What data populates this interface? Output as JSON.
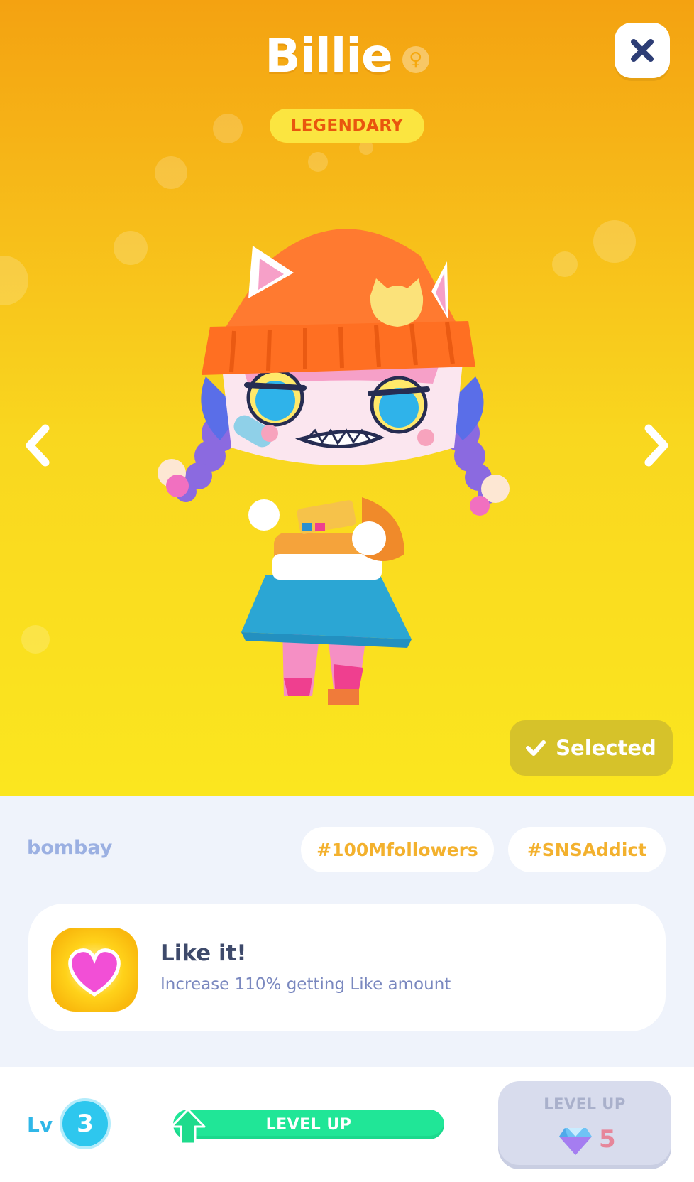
{
  "header": {
    "character_name": "Billie",
    "gender_symbol": "♀",
    "gender_icon": "female-icon",
    "rarity": "LEGENDARY",
    "close_icon": "close-icon"
  },
  "navigation": {
    "prev_icon": "chevron-left-icon",
    "next_icon": "chevron-right-icon"
  },
  "selection": {
    "label": "Selected",
    "icon": "check-icon"
  },
  "info": {
    "artist": "bombay",
    "tags": [
      "#100Mfollowers",
      "#SNSAddict"
    ]
  },
  "skill": {
    "icon": "heart-icon",
    "title": "Like it!",
    "description": "Increase 110% getting Like amount"
  },
  "level": {
    "prefix": "Lv",
    "value": "3",
    "progress_label": "LEVEL UP",
    "progress_icon": "arrow-up-icon"
  },
  "level_up_button": {
    "label": "LEVEL UP",
    "cost": "5",
    "currency_icon": "gem-icon"
  },
  "colors": {
    "hero_top": "#f4a211",
    "hero_bottom": "#fbe61f",
    "rarity_text": "#e9560e",
    "tag_text": "#f3b12e",
    "level_accent": "#2ec7ee",
    "progress_fill": "#20e697",
    "cost_text": "#e6869a"
  }
}
